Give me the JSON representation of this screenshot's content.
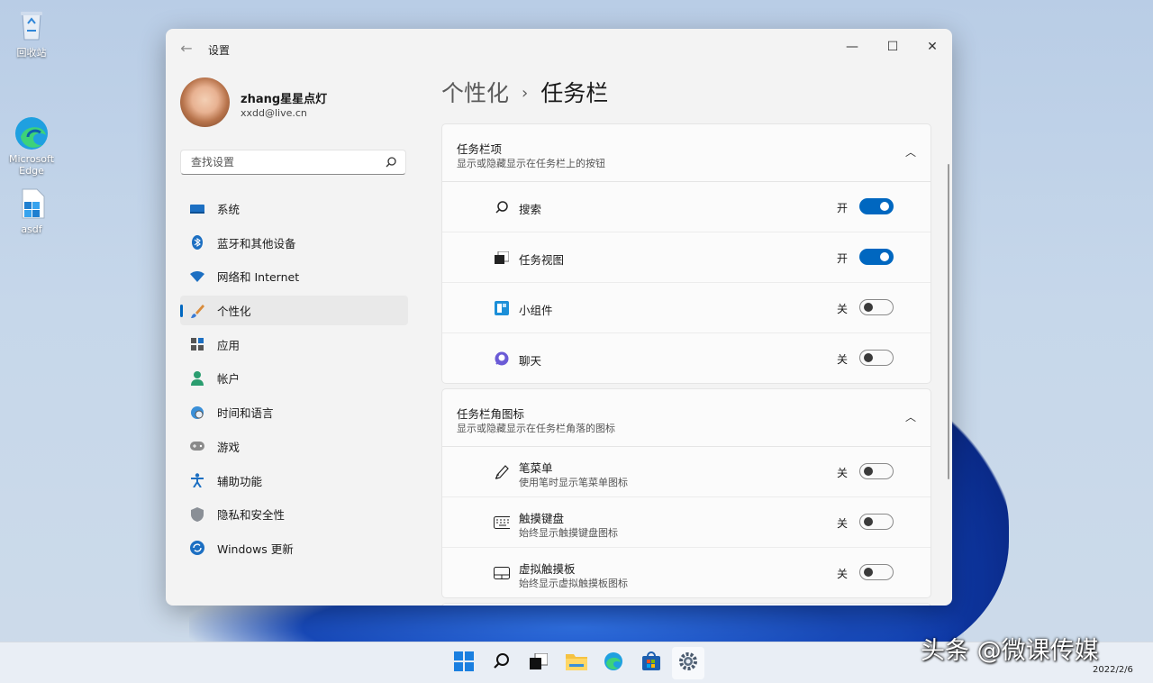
{
  "desktop": {
    "icons": [
      {
        "label": "回收站",
        "icon": "recycle-bin-icon"
      },
      {
        "label": "Microsoft\nEdge",
        "icon": "edge-icon"
      },
      {
        "label": "asdf",
        "icon": "file-icon"
      }
    ]
  },
  "window": {
    "title": "设置",
    "controls": {
      "minimize": "—",
      "maximize": "☐",
      "close": "✕"
    }
  },
  "profile": {
    "name": "zhang星星点灯",
    "email": "xxdd@live.cn"
  },
  "search": {
    "placeholder": "查找设置"
  },
  "nav": {
    "items": [
      {
        "label": "系统",
        "icon": "monitor-icon",
        "active": false
      },
      {
        "label": "蓝牙和其他设备",
        "icon": "bluetooth-icon",
        "active": false
      },
      {
        "label": "网络和 Internet",
        "icon": "wifi-icon",
        "active": false
      },
      {
        "label": "个性化",
        "icon": "brush-icon",
        "active": true
      },
      {
        "label": "应用",
        "icon": "apps-icon",
        "active": false
      },
      {
        "label": "帐户",
        "icon": "person-icon",
        "active": false
      },
      {
        "label": "时间和语言",
        "icon": "globe-clock-icon",
        "active": false
      },
      {
        "label": "游戏",
        "icon": "gamepad-icon",
        "active": false
      },
      {
        "label": "辅助功能",
        "icon": "accessibility-icon",
        "active": false
      },
      {
        "label": "隐私和安全性",
        "icon": "shield-icon",
        "active": false
      },
      {
        "label": "Windows 更新",
        "icon": "update-icon",
        "active": false
      }
    ]
  },
  "breadcrumb": {
    "parent": "个性化",
    "separator": "›",
    "current": "任务栏"
  },
  "sections": {
    "taskbar_items": {
      "title": "任务栏项",
      "subtitle": "显示或隐藏显示在任务栏上的按钮",
      "rows": {
        "search": {
          "label": "搜索",
          "state": "开",
          "on": true
        },
        "task_view": {
          "label": "任务视图",
          "state": "开",
          "on": true
        },
        "widgets": {
          "label": "小组件",
          "state": "关",
          "on": false
        },
        "chat": {
          "label": "聊天",
          "state": "关",
          "on": false
        }
      }
    },
    "corner_icons": {
      "title": "任务栏角图标",
      "subtitle": "显示或隐藏显示在任务栏角落的图标",
      "rows": {
        "pen_menu": {
          "label": "笔菜单",
          "sub": "使用笔时显示笔菜单图标",
          "state": "关",
          "on": false
        },
        "touch_keyboard": {
          "label": "触摸键盘",
          "sub": "始终显示触摸键盘图标",
          "state": "关",
          "on": false
        },
        "virtual_touchpad": {
          "label": "虚拟触摸板",
          "sub": "始终显示虚拟触摸板图标",
          "state": "关",
          "on": false
        }
      }
    }
  },
  "taskbar": {
    "apps": [
      "start-icon",
      "search-icon",
      "task-view-icon",
      "file-explorer-icon",
      "edge-icon",
      "store-icon",
      "settings-icon"
    ],
    "date": "2022/2/6"
  },
  "watermark": "头条 @微课传媒",
  "colors": {
    "accent": "#0067c0",
    "window_bg": "#f3f3f3",
    "card_bg": "#fbfbfb"
  }
}
